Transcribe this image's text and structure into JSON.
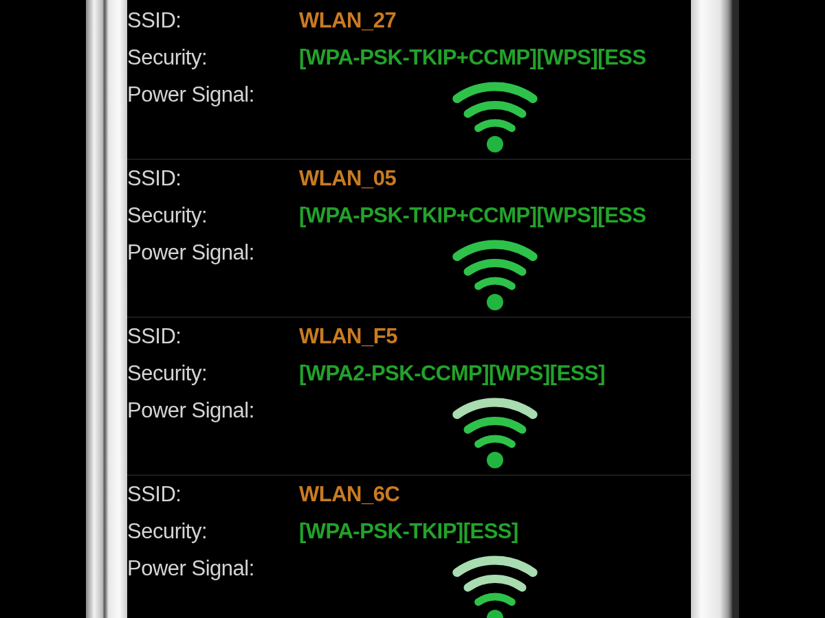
{
  "networks": [
    {
      "ssid_label": "SSID:",
      "ssid": "WLAN_27",
      "security_label": "Security:",
      "security": "[WPA-PSK-TKIP+CCMP][WPS][ESS",
      "signal_label": "Power Signal:",
      "kind": "strong"
    },
    {
      "ssid_label": "SSID:",
      "ssid": "WLAN_05",
      "security_label": "Security:",
      "security": "[WPA-PSK-TKIP+CCMP][WPS][ESS",
      "signal_label": "Power Signal:",
      "kind": "strong"
    },
    {
      "ssid_label": "SSID:",
      "ssid": "WLAN_F5",
      "security_label": "Security:",
      "security": "[WPA2-PSK-CCMP][WPS][ESS]",
      "signal_label": "Power Signal:",
      "kind": "good"
    },
    {
      "ssid_label": "SSID:",
      "ssid": "WLAN_6C",
      "security_label": "Security:",
      "security": "[WPA-PSK-TKIP][ESS]",
      "signal_label": "Power Signal:",
      "kind": "fair"
    }
  ]
}
